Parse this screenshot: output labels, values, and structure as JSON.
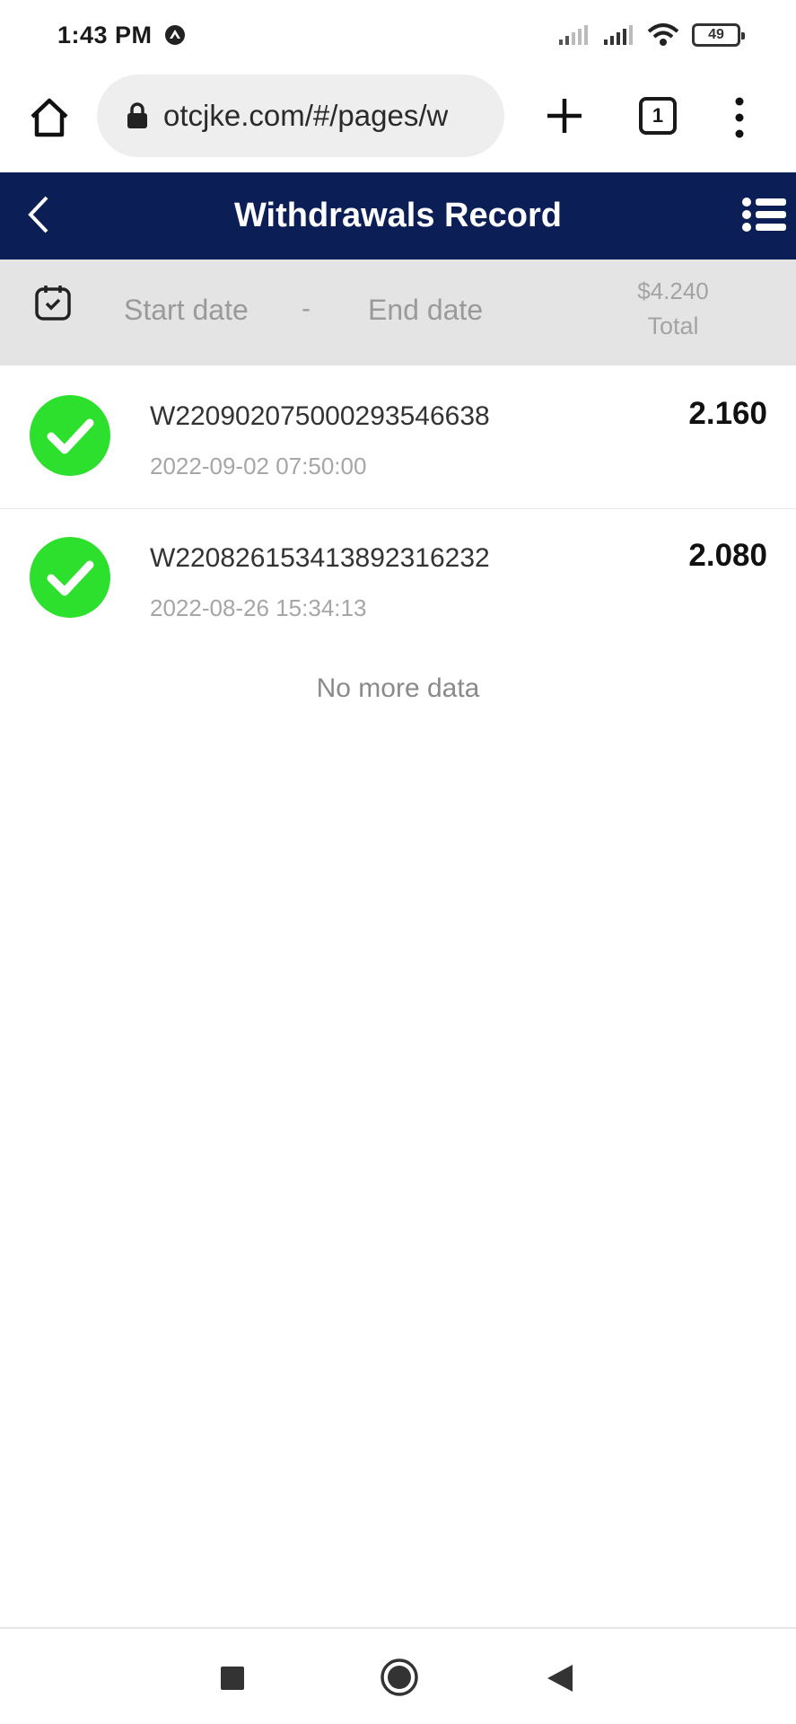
{
  "status_bar": {
    "time": "1:43 PM",
    "battery": "49"
  },
  "browser": {
    "url": "otcjke.com/#/pages/w",
    "tab_count": "1"
  },
  "header": {
    "title": "Withdrawals Record"
  },
  "filter": {
    "start_placeholder": "Start date",
    "separator": "-",
    "end_placeholder": "End date",
    "total_amount": "$4.240",
    "total_label": "Total"
  },
  "records": [
    {
      "id": "W220902075000293546638",
      "time": "2022-09-02 07:50:00",
      "amount": "2.160"
    },
    {
      "id": "W220826153413892316232",
      "time": "2022-08-26 15:34:13",
      "amount": "2.080"
    }
  ],
  "list_end_text": "No more data",
  "colors": {
    "header_bg": "#0b1f56",
    "success_green": "#2de02d"
  }
}
